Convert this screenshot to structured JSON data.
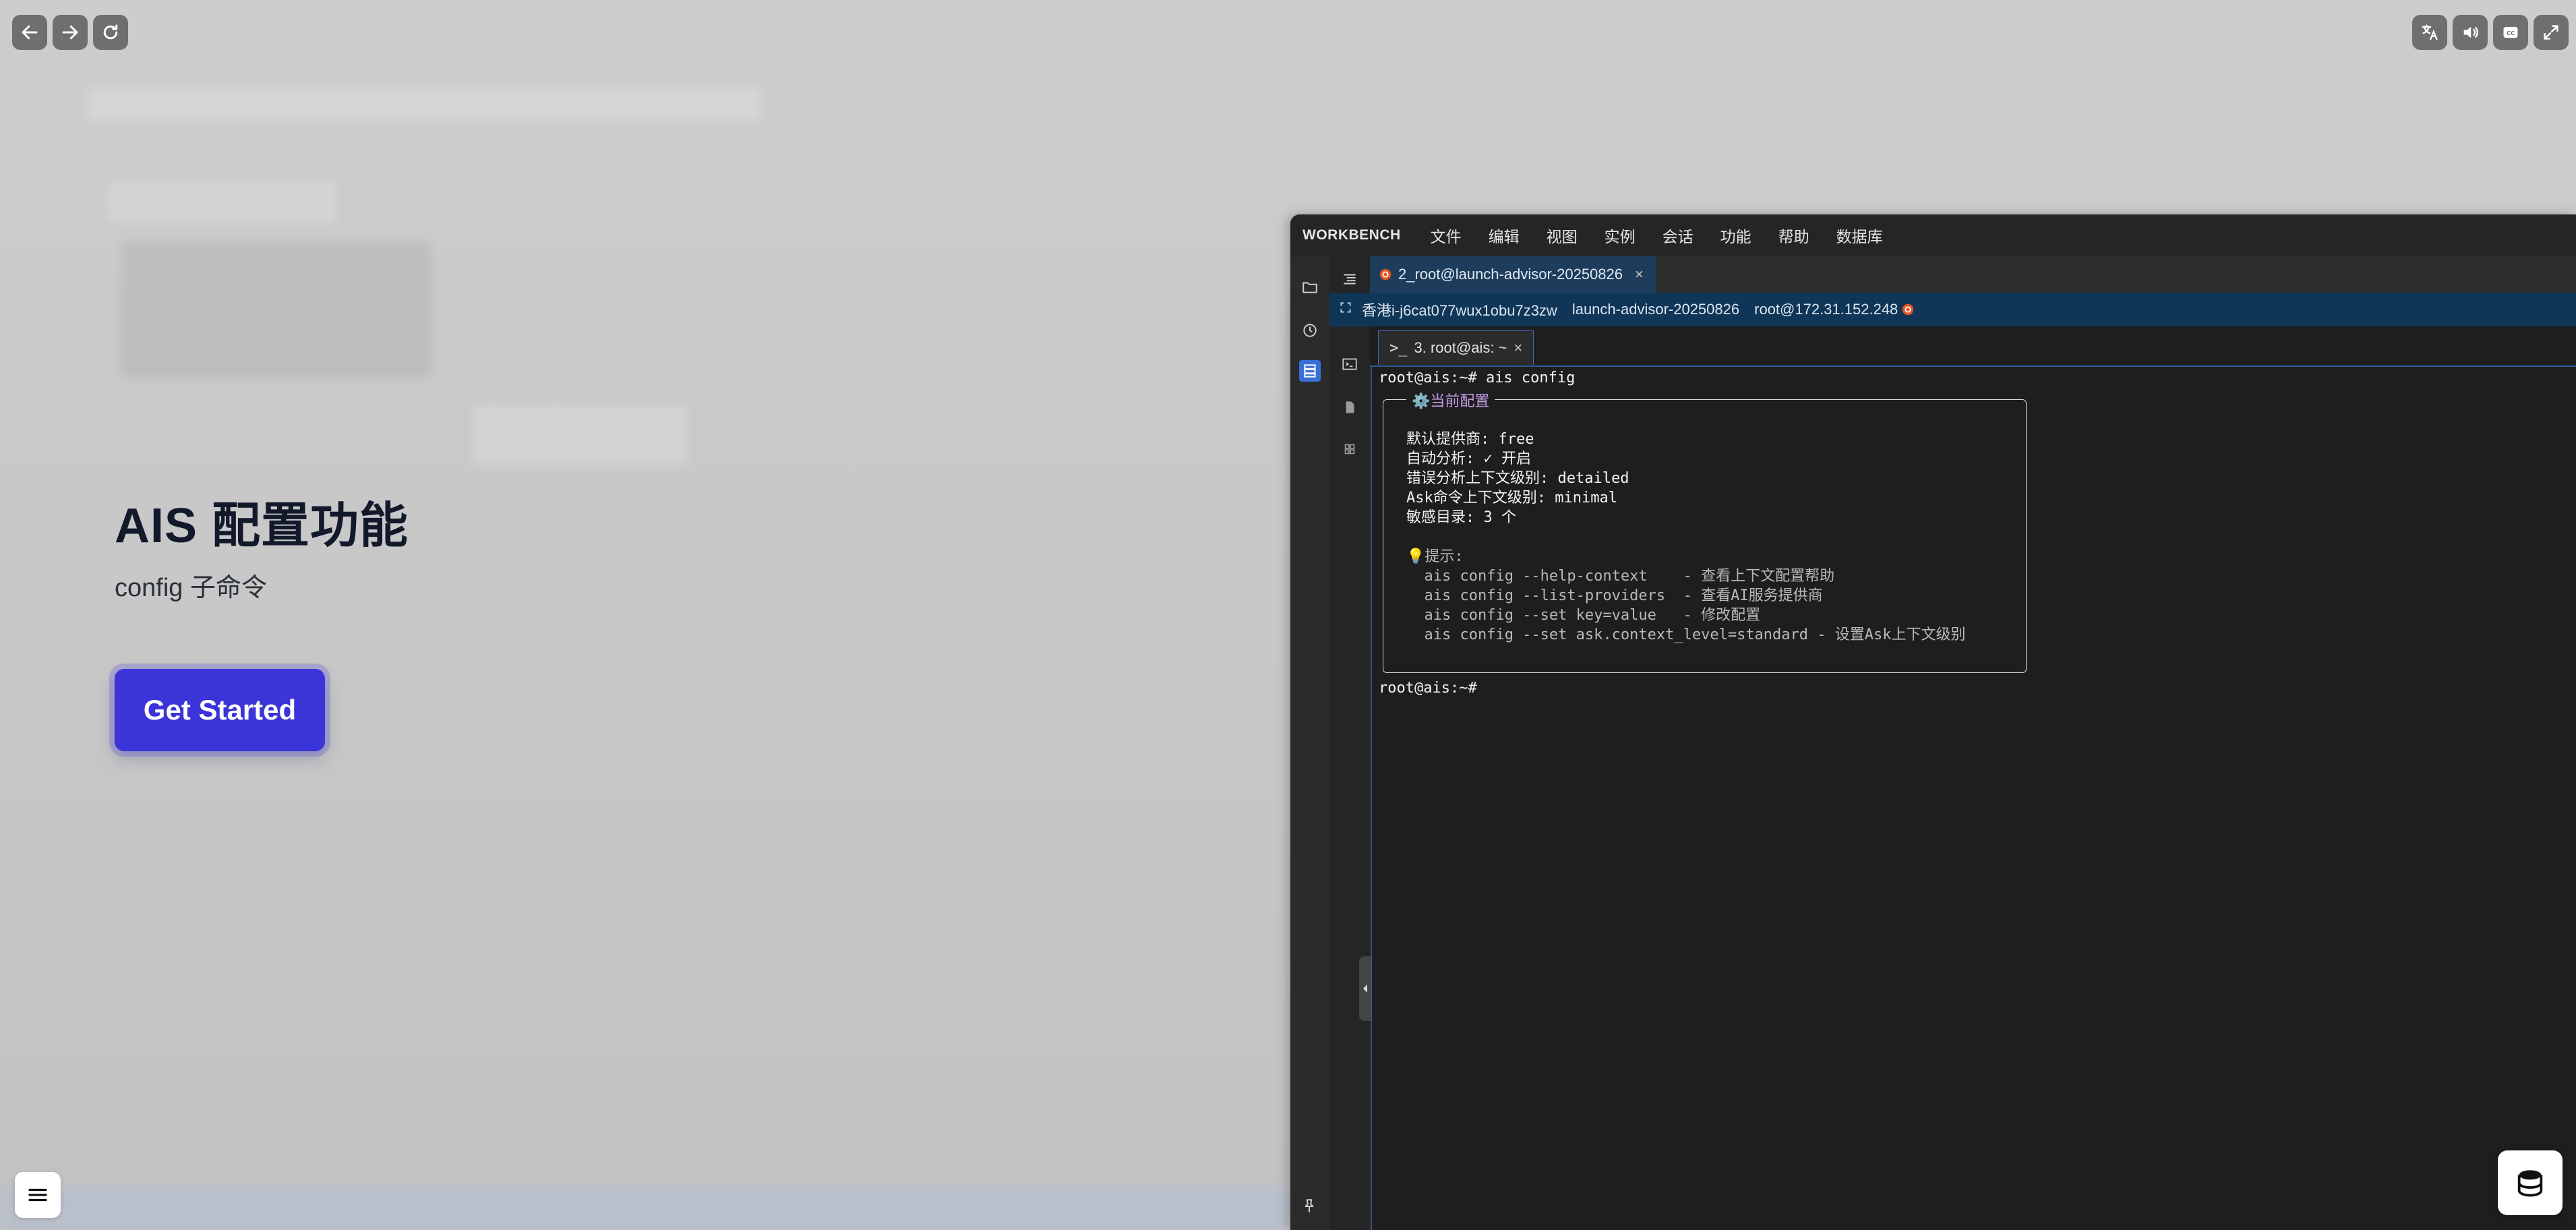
{
  "hero": {
    "title": "AIS 配置功能",
    "subtitle": "config 子命令",
    "cta_label": "Get Started"
  },
  "workbench": {
    "brand": "WORKBENCH",
    "menu": [
      "文件",
      "编辑",
      "视图",
      "实例",
      "会话",
      "功能",
      "帮助",
      "数据库"
    ],
    "editor_tab": "2_root@launch-advisor-20250826",
    "info": {
      "instance": "香港i-j6cat077wux1obu7z3zw",
      "name": "launch-advisor-20250826",
      "login": "root@172.31.152.248"
    },
    "terminal_tab": "3. root@ais: ~",
    "terminal": {
      "prompt_line": "root@ais:~# ais config",
      "box_title": "⚙️当前配置",
      "lines": [
        "默认提供商: free",
        "自动分析: ✓ 开启",
        "错误分析上下文级别: detailed",
        "Ask命令上下文级别: minimal",
        "敏感目录: 3 个"
      ],
      "tips_header": "💡提示:",
      "tips": [
        "  ais config --help-context    - 查看上下文配置帮助",
        "  ais config --list-providers  - 查看AI服务提供商",
        "  ais config --set key=value   - 修改配置",
        "  ais config --set ask.context_level=standard - 设置Ask上下文级别"
      ],
      "final_prompt": "root@ais:~#"
    }
  },
  "colors": {
    "cta": "#3b34d8",
    "terminal_bg": "#1e1e1e",
    "box_title": "#c59be6"
  }
}
